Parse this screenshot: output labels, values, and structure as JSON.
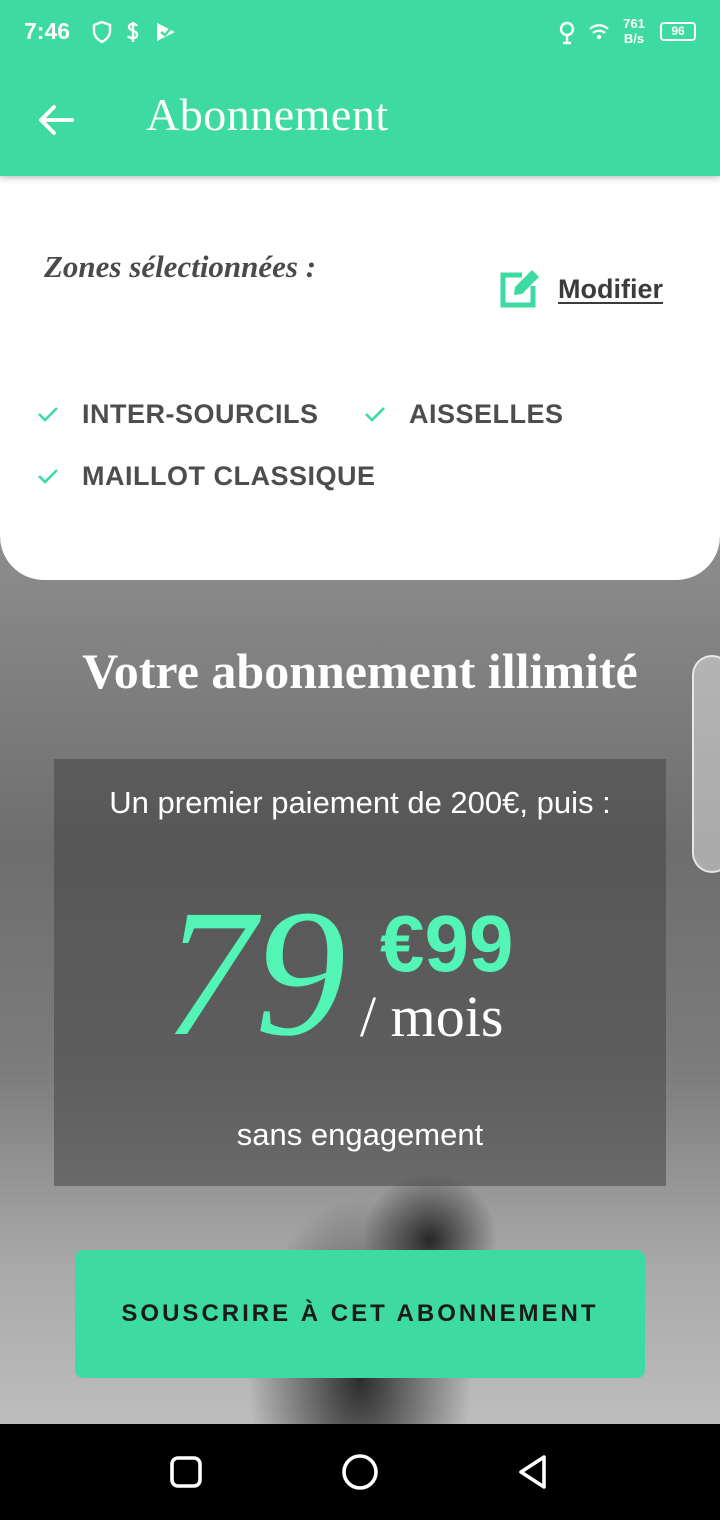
{
  "status_bar": {
    "time": "7:46",
    "net_speed_value": "761",
    "net_speed_unit": "B/s",
    "battery": "96"
  },
  "app_bar": {
    "title": "Abonnement",
    "back_icon": "arrow-left-icon",
    "background_color": "#3ddba2"
  },
  "zones": {
    "label": "Zones sélectionnées :",
    "modify_label": "Modifier",
    "modify_icon": "edit-icon",
    "items": [
      {
        "label": "INTER-SOURCILS"
      },
      {
        "label": "AISSELLES"
      },
      {
        "label": "MAILLOT CLASSIQUE"
      }
    ]
  },
  "subscription": {
    "title": "Votre abonnement illimité",
    "first_payment": "Un premier paiement de 200€, puis :",
    "price_integer": "79",
    "price_decimal": "€99",
    "price_unit": "/ mois",
    "commitment": "sans engagement",
    "cta_label": "SOUSCRIRE À CET ABONNEMENT",
    "price_color": "#52f5b5"
  },
  "navigation": {
    "recents_icon": "square-icon",
    "home_icon": "circle-icon",
    "back_icon": "triangle-back-icon"
  }
}
